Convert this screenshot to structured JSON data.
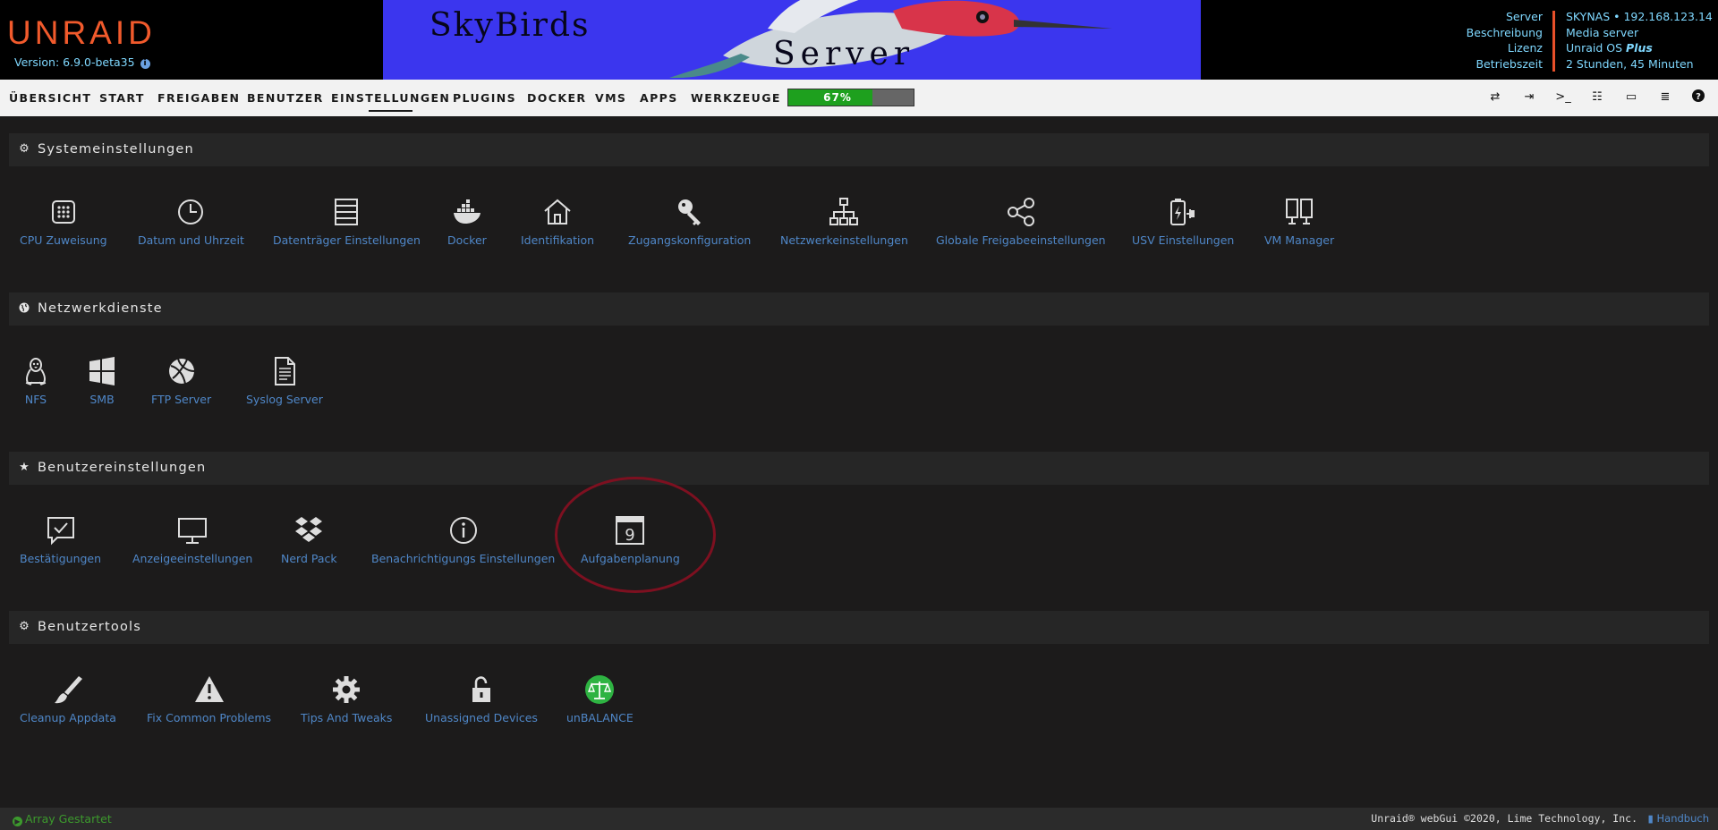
{
  "header": {
    "logo": "UNRAID",
    "version": "Version: 6.9.0-beta35",
    "banner_line1": "SkyBirds",
    "banner_line2": "Server",
    "server_info": {
      "labels": [
        "Server",
        "Beschreibung",
        "Lizenz",
        "Betriebszeit"
      ],
      "server": "SKYNAS • 192.168.123.14",
      "description": "Media server",
      "license_prefix": "Unraid OS ",
      "license_tier": "Plus",
      "uptime": "2 Stunden, 45 Minuten"
    }
  },
  "menu": {
    "items": [
      "ÜBERSICHT",
      "START",
      "FREIGABEN",
      "BENUTZER",
      "EINSTELLUNGEN",
      "PLUGINS",
      "DOCKER",
      "VMS",
      "APPS",
      "WERKZEUGE"
    ],
    "active": "EINSTELLUNGEN",
    "progress_label": "67%",
    "progress_value": 0.67,
    "toolbar_icons": [
      "switch-icon",
      "logout-icon",
      "terminal-icon",
      "feedback-icon",
      "display-icon",
      "log-icon",
      "help-icon"
    ]
  },
  "sections": {
    "system": {
      "title": "Systemeinstellungen",
      "icon": "gear-icon",
      "tiles": [
        "CPU Zuweisung",
        "Datum und Uhrzeit",
        "Datenträger Einstellungen",
        "Docker",
        "Identifikation",
        "Zugangskonfiguration",
        "Netzwerkeinstellungen",
        "Globale Freigabeeinstellungen",
        "USV Einstellungen",
        "VM Manager"
      ]
    },
    "network": {
      "title": "Netzwerkdienste",
      "icon": "globe-icon",
      "tiles": [
        "NFS",
        "SMB",
        "FTP Server",
        "Syslog Server"
      ]
    },
    "user_settings": {
      "title": "Benutzereinstellungen",
      "icon": "star-icon",
      "tiles": [
        "Bestätigungen",
        "Anzeigeeinstellungen",
        "Nerd Pack",
        "Benachrichtigungs Einstellungen",
        "Aufgabenplanung"
      ],
      "scheduler_day": "9"
    },
    "user_tools": {
      "title": "Benutzertools",
      "icon": "gears-icon",
      "tiles": [
        "Cleanup Appdata",
        "Fix Common Problems",
        "Tips And Tweaks",
        "Unassigned Devices",
        "unBALANCE"
      ]
    }
  },
  "footer": {
    "status": "Array Gestartet",
    "copyright": "Unraid® webGui ©2020, Lime Technology, Inc.",
    "manual": "Handbuch"
  },
  "colors": {
    "logo": "#f15a2c",
    "link": "#4f87c8",
    "info_text": "#7fd8ff",
    "banner_bg": "#3b36ee",
    "progress_fill": "#1ea01e",
    "status_green": "#3c9a2d",
    "highlight_circle": "#7d1020"
  }
}
